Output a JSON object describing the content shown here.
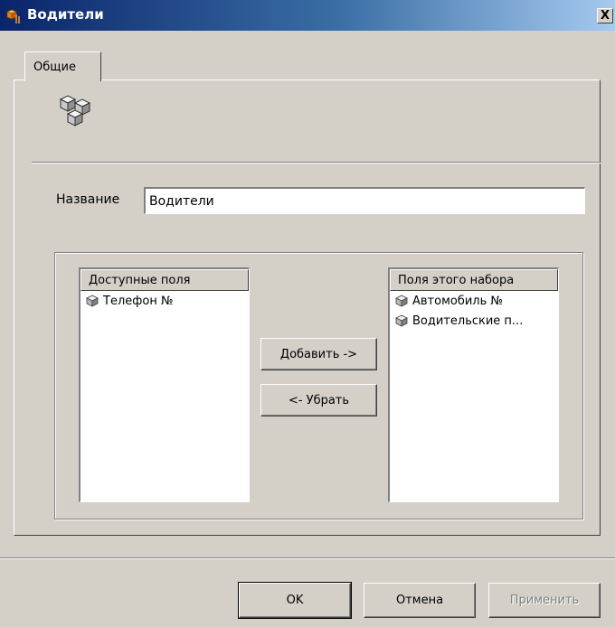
{
  "window": {
    "title": "Водители",
    "close_label": "X"
  },
  "tabs": [
    {
      "label": "Общие"
    }
  ],
  "name_field": {
    "label": "Название",
    "value": "Водители"
  },
  "available_fields": {
    "header": "Доступные поля",
    "items": [
      {
        "label": "Телефон №",
        "icon": "field-icon"
      }
    ]
  },
  "set_fields": {
    "header": "Поля этого набора",
    "items": [
      {
        "label": "Автомобиль №",
        "icon": "field-icon"
      },
      {
        "label": "Водительские п...",
        "icon": "field-icon"
      }
    ]
  },
  "buttons": {
    "add": "Добавить ->",
    "remove": "<- Убрать",
    "ok": "OK",
    "cancel": "Отмена",
    "apply": "Применить"
  }
}
